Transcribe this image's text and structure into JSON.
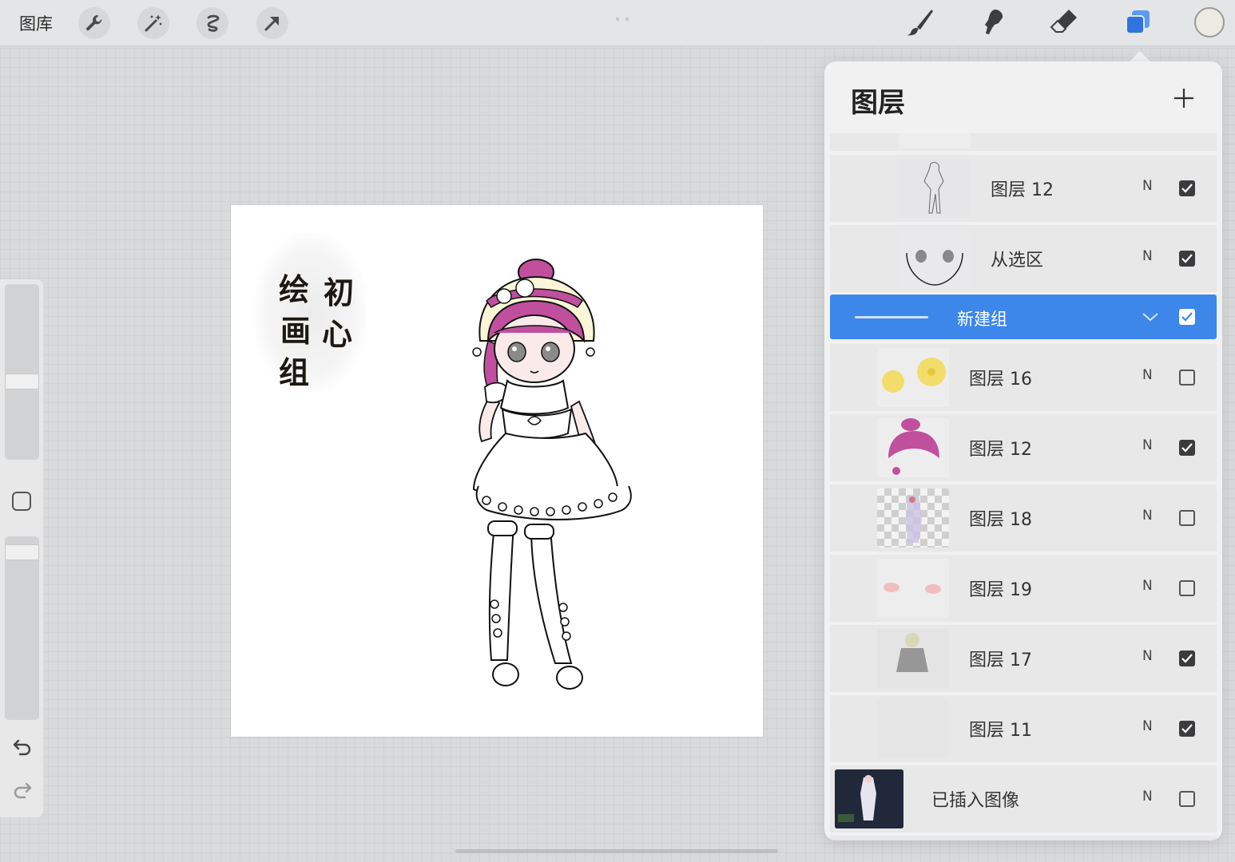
{
  "topbar": {
    "gallery_label": "图库",
    "left_tools": [
      "wrench-icon",
      "magic-wand-icon",
      "selection-icon",
      "transform-arrow-icon"
    ],
    "right_tools": [
      "brush-icon",
      "smudge-icon",
      "eraser-icon",
      "layers-icon"
    ],
    "current_color": "#ecebe2",
    "accent": "#3a7be0"
  },
  "canvas": {
    "artwork_text": [
      "绘",
      "画",
      "组",
      "初",
      "心"
    ]
  },
  "layers_panel": {
    "title": "图层",
    "add_icon": "plus-icon",
    "layers": [
      {
        "name": "图层 12",
        "mode": "N",
        "visible": true
      },
      {
        "name": "从选区",
        "mode": "N",
        "visible": true
      },
      {
        "name": "新建组",
        "is_group": true,
        "selected": true,
        "visible": true
      },
      {
        "name": "图层 16",
        "mode": "N",
        "visible": false
      },
      {
        "name": "图层 12",
        "mode": "N",
        "visible": true
      },
      {
        "name": "图层 18",
        "mode": "N",
        "visible": false
      },
      {
        "name": "图层 19",
        "mode": "N",
        "visible": false
      },
      {
        "name": "图层 17",
        "mode": "N",
        "visible": true
      },
      {
        "name": "图层 11",
        "mode": "N",
        "visible": true
      },
      {
        "name": "已插入图像",
        "mode": "N",
        "visible": false
      }
    ]
  }
}
